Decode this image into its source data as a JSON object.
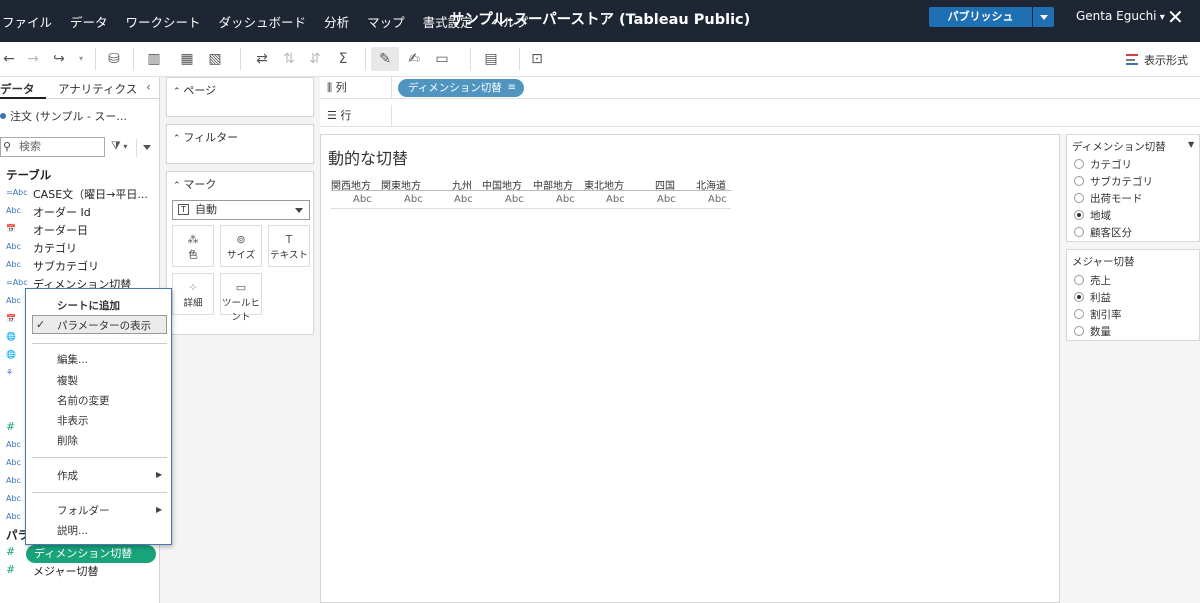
{
  "menu": [
    "ファイル",
    "データ",
    "ワークシート",
    "ダッシュボード",
    "分析",
    "マップ",
    "書式設定",
    "ヘルプ"
  ],
  "app_title": "サンプル-スーパーストア (Tableau Public)",
  "publish_label": "パブリッシュ",
  "user_name": "Genta Eguchi",
  "toolbar": {
    "show_me_label": "表示形式"
  },
  "datapane": {
    "tab_data": "データ",
    "tab_analytics": "アナリティクス",
    "datasource": "注文 (サンプル - スー...",
    "search_placeholder": "検索",
    "tables_label": "テーブル",
    "params_label": "パラ",
    "fields": [
      {
        "type": "=Abc",
        "name": "CASE文（曜日→平日..."
      },
      {
        "type": "Abc",
        "name": "オーダー Id"
      },
      {
        "type": "📅",
        "name": "オーダー日"
      },
      {
        "type": "Abc",
        "name": "カテゴリ"
      },
      {
        "type": "Abc",
        "name": "サブカテゴリ"
      },
      {
        "type": "=Abc",
        "name": "ディメンション切替"
      }
    ],
    "param_pill": "ディメンション切替",
    "param_field": "メジャー切替"
  },
  "shelves": {
    "pages_label": "ページ",
    "filters_label": "フィルター",
    "marks_label": "マーク",
    "marks_type": "自動",
    "mark_buttons": [
      "色",
      "サイズ",
      "テキスト",
      "詳細",
      "ツールヒント"
    ],
    "columns_label": "列",
    "rows_label": "行",
    "column_pill": "ディメンション切替"
  },
  "view": {
    "title": "動的な切替",
    "headers": [
      "関西地方",
      "関東地方",
      "九州",
      "中国地方",
      "中部地方",
      "東北地方",
      "四国",
      "北海道"
    ],
    "cell_text": "Abc"
  },
  "right_panel": {
    "param1_title": "ディメンション切替",
    "param1_options": [
      "カテゴリ",
      "サブカテゴリ",
      "出荷モード",
      "地域",
      "顧客区分"
    ],
    "param1_selected": 3,
    "param2_title": "メジャー切替",
    "param2_options": [
      "売上",
      "利益",
      "割引率",
      "数量"
    ],
    "param2_selected": 1
  },
  "context_menu": {
    "add_to_sheet": "シートに追加",
    "show_parameter": "パラメーターの表示",
    "edit": "編集...",
    "duplicate": "複製",
    "rename": "名前の変更",
    "hide": "非表示",
    "delete": "削除",
    "create": "作成",
    "folder": "フォルダー",
    "describe": "説明..."
  }
}
